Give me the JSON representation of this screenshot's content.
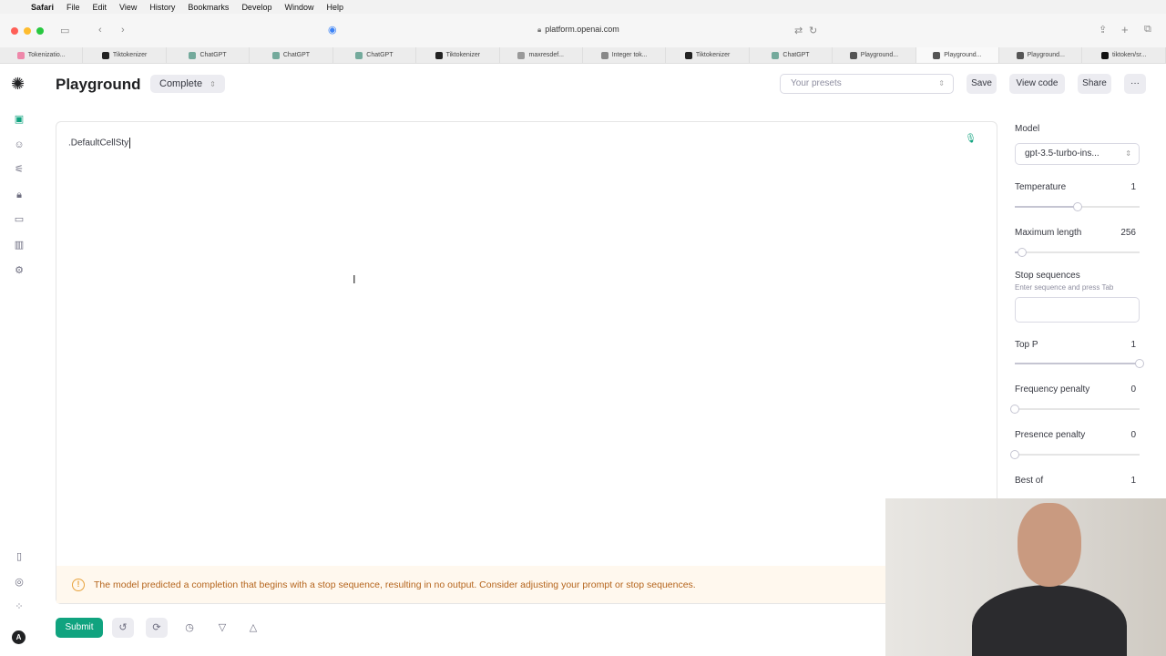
{
  "menubar": {
    "items": [
      "Safari",
      "File",
      "Edit",
      "View",
      "History",
      "Bookmarks",
      "Develop",
      "Window",
      "Help"
    ]
  },
  "browser": {
    "url": "platform.openai.com"
  },
  "tabs": [
    {
      "label": "Tokenizatio..."
    },
    {
      "label": "Tiktokenizer"
    },
    {
      "label": "ChatGPT"
    },
    {
      "label": "ChatGPT"
    },
    {
      "label": "ChatGPT"
    },
    {
      "label": "Tiktokenizer"
    },
    {
      "label": "maxresdef..."
    },
    {
      "label": "Integer tok..."
    },
    {
      "label": "Tiktokenizer"
    },
    {
      "label": "ChatGPT"
    },
    {
      "label": "Playground..."
    },
    {
      "label": "Playground..."
    },
    {
      "label": "Playground..."
    },
    {
      "label": "tiktoken/sr..."
    }
  ],
  "header": {
    "title": "Playground",
    "mode": "Complete",
    "presets_placeholder": "Your presets",
    "save": "Save",
    "view_code": "View code",
    "share": "Share",
    "more": "···"
  },
  "editor": {
    "text": ".DefaultCellSty",
    "warning": "The model predicted a completion that begins with a stop sequence, resulting in no output. Consider adjusting your prompt or stop sequences."
  },
  "footer": {
    "submit": "Submit"
  },
  "settings": {
    "model_label": "Model",
    "model_value": "gpt-3.5-turbo-ins...",
    "temperature_label": "Temperature",
    "temperature_value": "1",
    "temperature_level": 0.5,
    "max_length_label": "Maximum length",
    "max_length_value": "256",
    "max_length_level": 0.06,
    "stop_label": "Stop sequences",
    "stop_hint": "Enter sequence and press Tab",
    "top_p_label": "Top P",
    "top_p_value": "1",
    "top_p_level": 1.0,
    "freq_label": "Frequency penalty",
    "freq_value": "0",
    "freq_level": 0.0,
    "presence_label": "Presence penalty",
    "presence_value": "0",
    "presence_level": 0.0,
    "best_of_label": "Best of",
    "best_of_value": "1"
  },
  "colors": {
    "accent": "#10a37f",
    "warning_text": "#b5651d",
    "warning_bg": "#fff8ee"
  }
}
